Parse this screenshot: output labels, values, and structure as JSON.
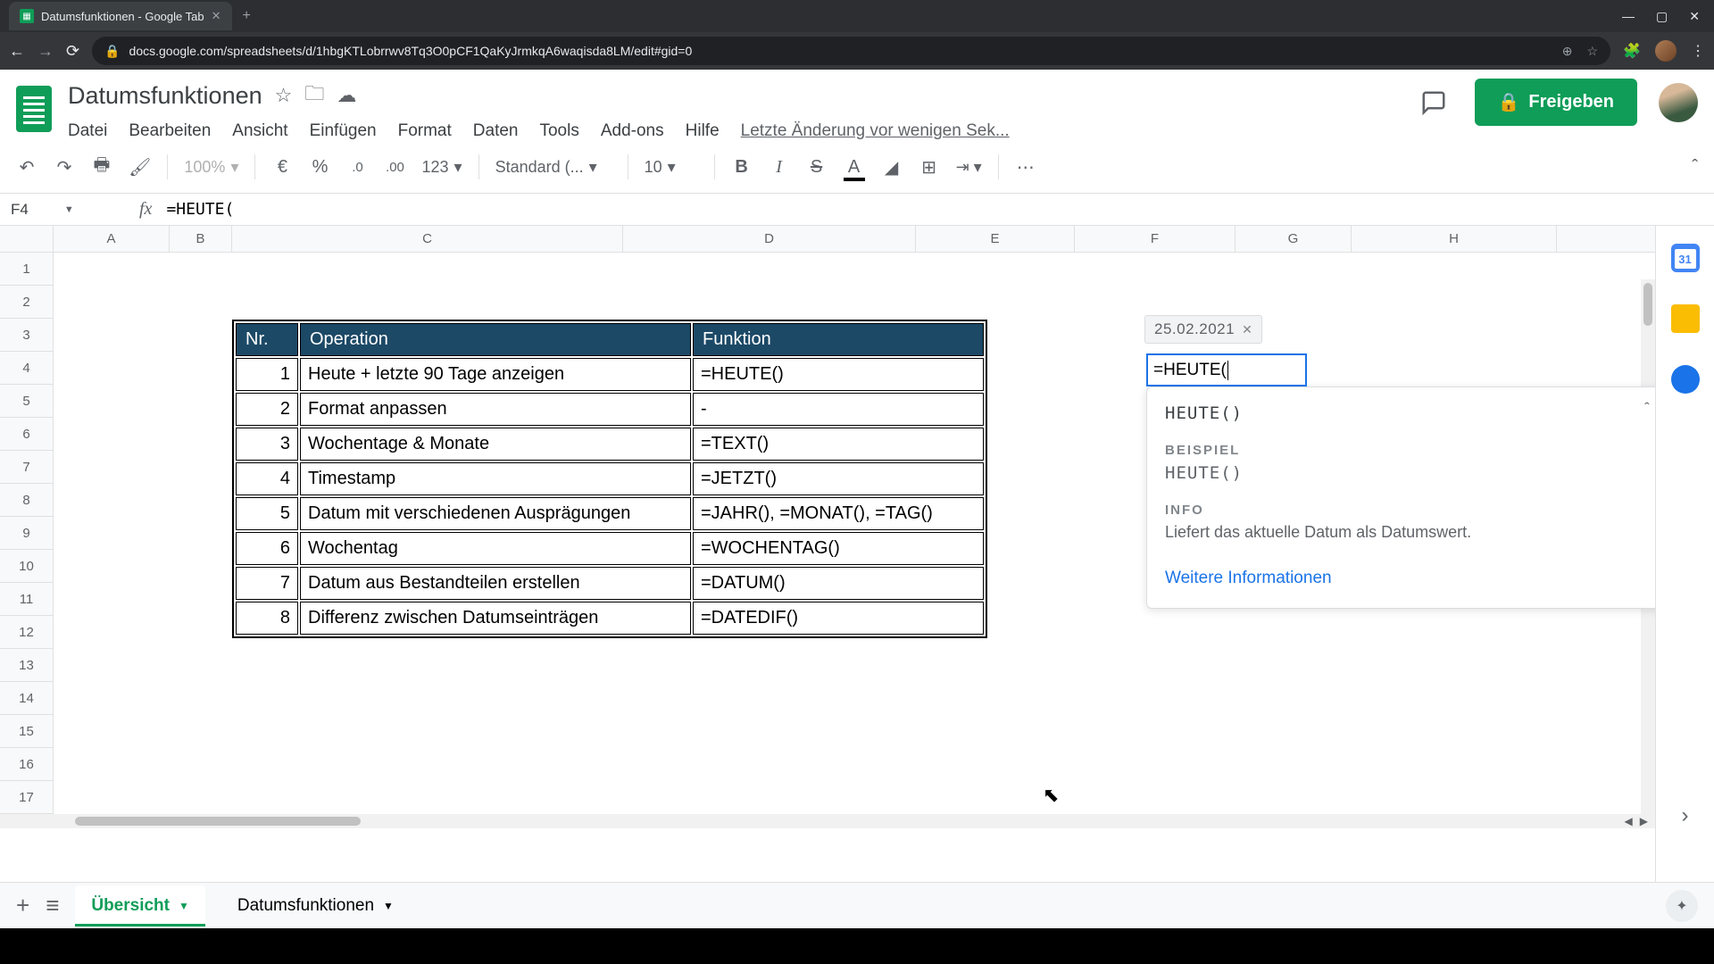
{
  "browser": {
    "tab_title": "Datumsfunktionen - Google Tab",
    "url": "docs.google.com/spreadsheets/d/1hbgKTLobrrwv8Tq3O0pCF1QaKyJrmkqA6waqisda8LM/edit#gid=0"
  },
  "doc": {
    "title": "Datumsfunktionen",
    "menu": [
      "Datei",
      "Bearbeiten",
      "Ansicht",
      "Einfügen",
      "Format",
      "Daten",
      "Tools",
      "Add-ons",
      "Hilfe"
    ],
    "last_edit": "Letzte Änderung vor wenigen Sek...",
    "share_label": "Freigeben"
  },
  "toolbar": {
    "zoom": "100%",
    "currency": "€",
    "percent": "%",
    "dec_less": ".0",
    "dec_more": ".00",
    "fmt123": "123",
    "font": "Standard (...",
    "size": "10"
  },
  "formula": {
    "name_box": "F4",
    "value": "=HEUTE("
  },
  "columns": [
    "A",
    "B",
    "C",
    "D",
    "E",
    "F",
    "G",
    "H"
  ],
  "table": {
    "headers": [
      "Nr.",
      "Operation",
      "Funktion"
    ],
    "rows": [
      {
        "nr": "1",
        "op": "Heute + letzte 90 Tage anzeigen",
        "fn": "=HEUTE()"
      },
      {
        "nr": "2",
        "op": "Format anpassen",
        "fn": "-"
      },
      {
        "nr": "3",
        "op": "Wochentage & Monate",
        "fn": "=TEXT()"
      },
      {
        "nr": "4",
        "op": "Timestamp",
        "fn": "=JETZT()"
      },
      {
        "nr": "5",
        "op": "Datum mit verschiedenen Ausprägungen",
        "fn": "=JAHR(), =MONAT(), =TAG()"
      },
      {
        "nr": "6",
        "op": "Wochentag",
        "fn": "=WOCHENTAG()"
      },
      {
        "nr": "7",
        "op": "Datum aus Bestandteilen erstellen",
        "fn": "=DATUM()"
      },
      {
        "nr": "8",
        "op": "Differenz zwischen Datumseinträgen",
        "fn": "=DATEDIF()"
      }
    ]
  },
  "active_cell": {
    "value": "=HEUTE(",
    "preview": "25.02.2021"
  },
  "help": {
    "signature": "HEUTE()",
    "example_label": "BEISPIEL",
    "example": "HEUTE()",
    "info_label": "INFO",
    "description": "Liefert das aktuelle Datum als Datumswert.",
    "link": "Weitere Informationen"
  },
  "sheets": {
    "tabs": [
      {
        "name": "Übersicht",
        "active": true
      },
      {
        "name": "Datumsfunktionen",
        "active": false
      }
    ]
  }
}
